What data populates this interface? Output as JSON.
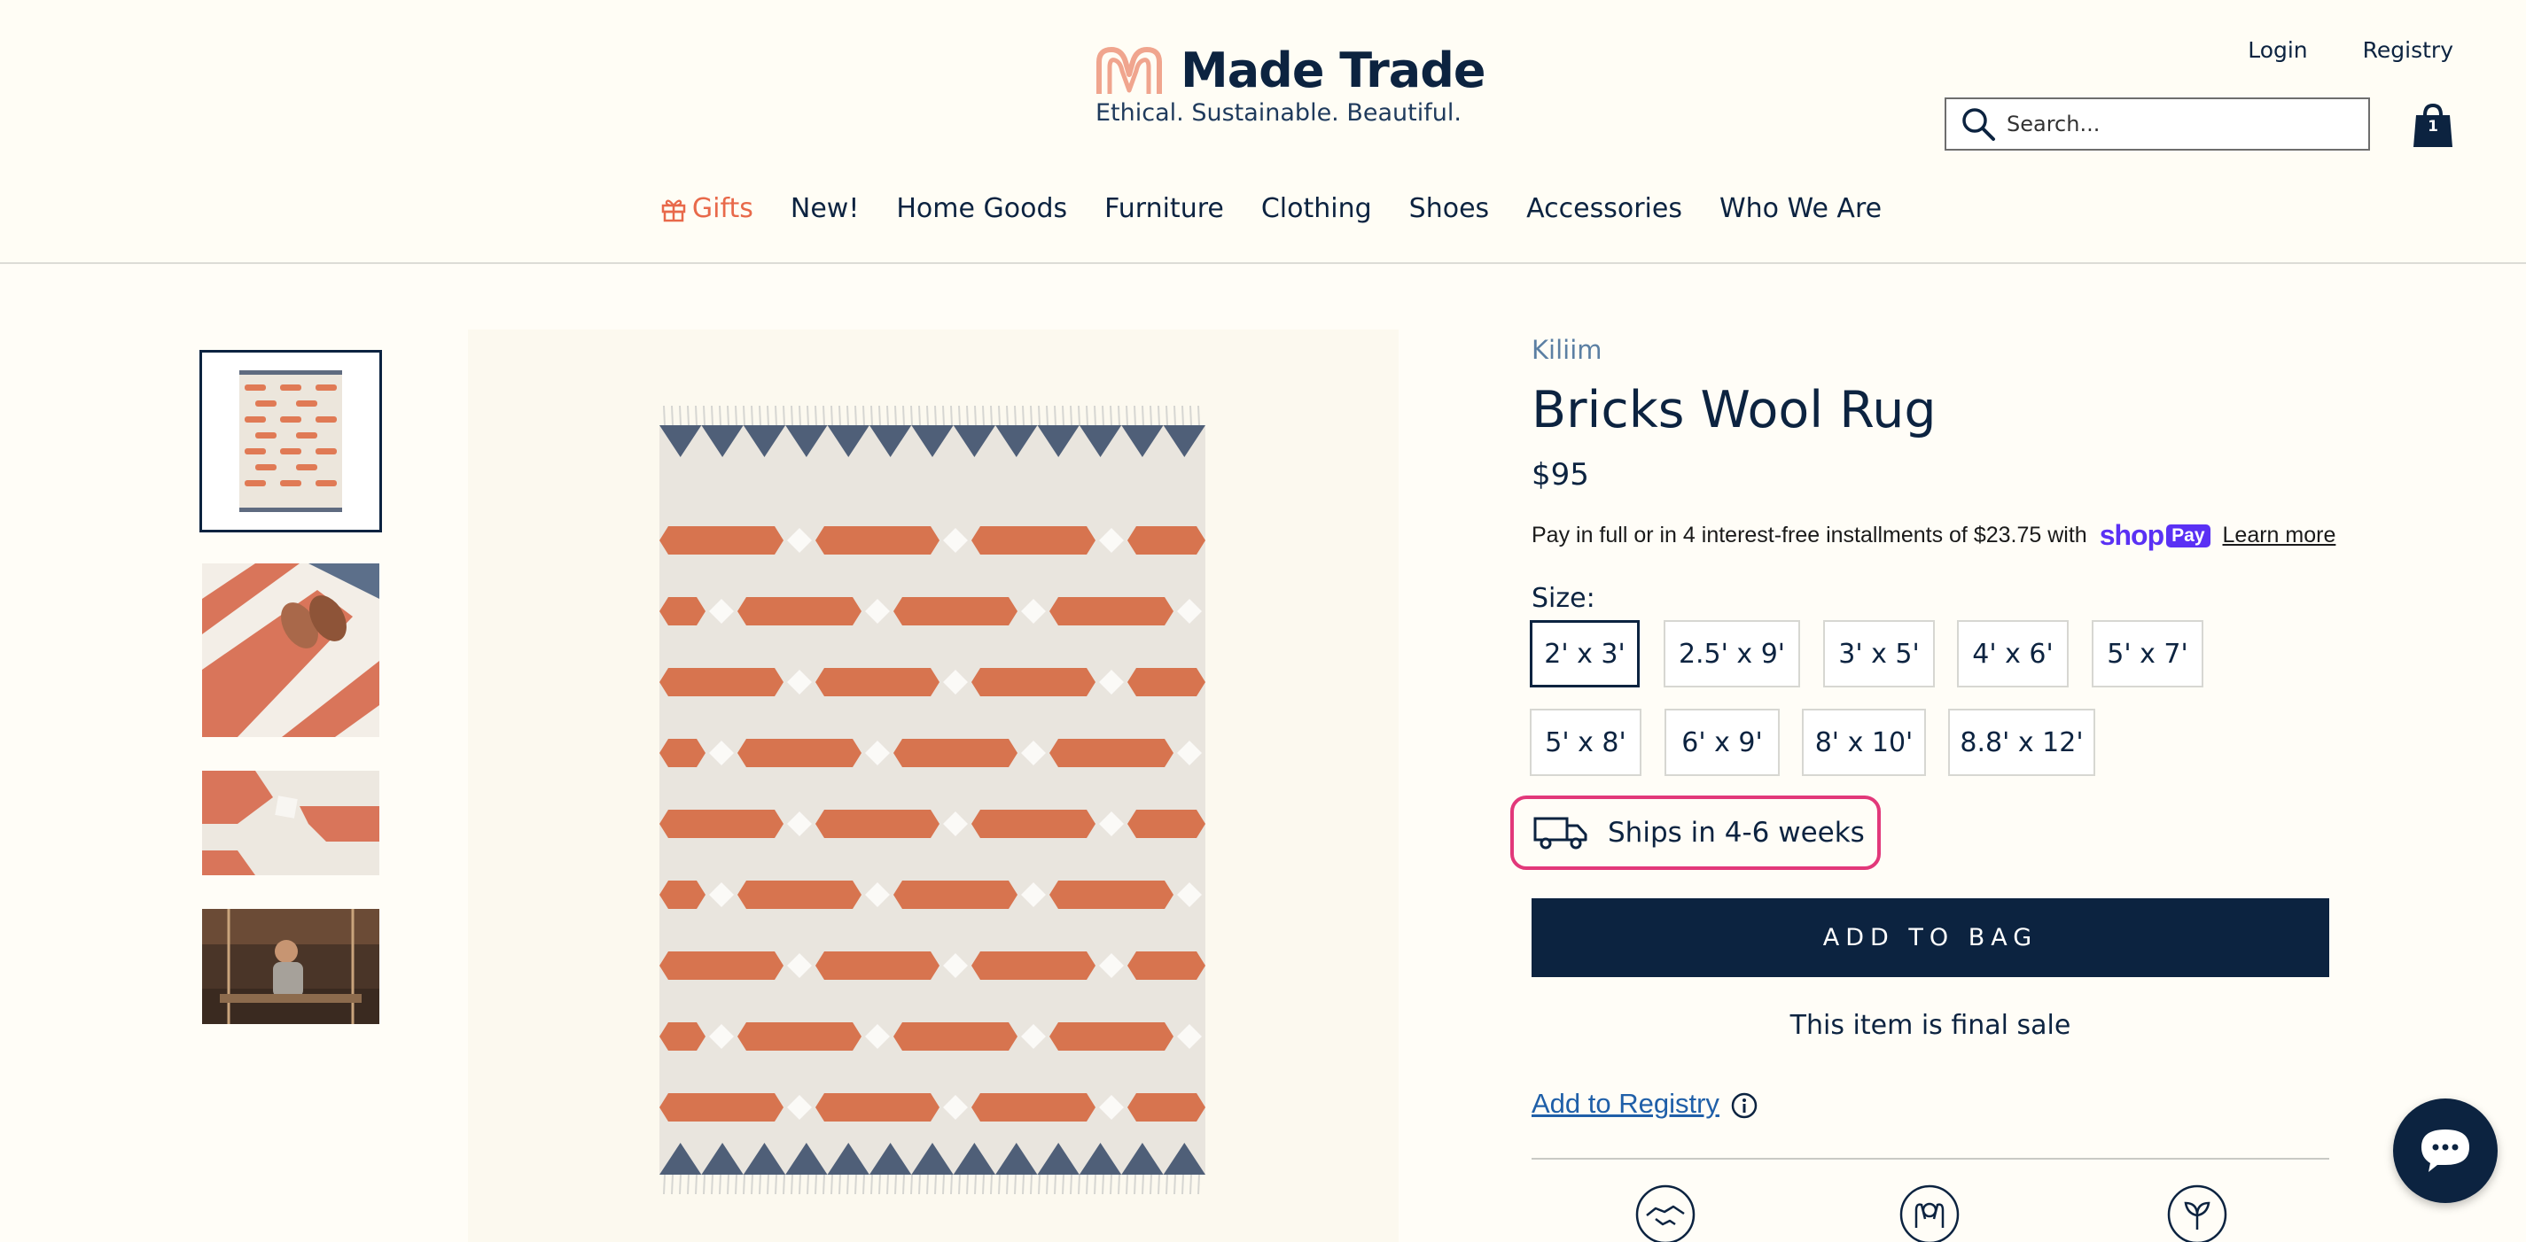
{
  "header": {
    "brand_name": "Made Trade",
    "tagline": "Ethical. Sustainable. Beautiful.",
    "login": "Login",
    "registry": "Registry",
    "search_placeholder": "Search...",
    "cart_count": "1"
  },
  "nav": {
    "items": [
      {
        "label": "Gifts",
        "icon": "gift-icon"
      },
      {
        "label": "New!"
      },
      {
        "label": "Home Goods"
      },
      {
        "label": "Furniture"
      },
      {
        "label": "Clothing"
      },
      {
        "label": "Shoes"
      },
      {
        "label": "Accessories"
      },
      {
        "label": "Who We Are"
      }
    ]
  },
  "product": {
    "vendor": "Kiliim",
    "title": "Bricks Wool Rug",
    "price": "$95",
    "installments_text": "Pay in full or in 4 interest-free installments of $23.75 with",
    "shop_pay": {
      "shop": "shop",
      "pay": "Pay"
    },
    "learn_more": "Learn more",
    "size_label": "Size:",
    "sizes": [
      "2' x 3'",
      "2.5' x 9'",
      "3' x 5'",
      "4' x 6'",
      "5' x 7'",
      "5' x 8'",
      "6' x 9'",
      "8' x 10'",
      "8.8' x 12'"
    ],
    "selected_size": "2' x 3'",
    "shipping": "Ships in 4-6 weeks",
    "add_to_bag": "ADD TO BAG",
    "final_sale": "This item is final sale",
    "add_to_registry": "Add to Registry"
  },
  "gallery": {
    "thumbnail_count": 4,
    "active_thumbnail": 1
  },
  "colors": {
    "navy": "#0c2340",
    "accent_coral": "#e8694a",
    "highlight_pink": "#e2387a",
    "shop_pay_purple": "#5a31f4",
    "page_background": "#fffdf5"
  }
}
